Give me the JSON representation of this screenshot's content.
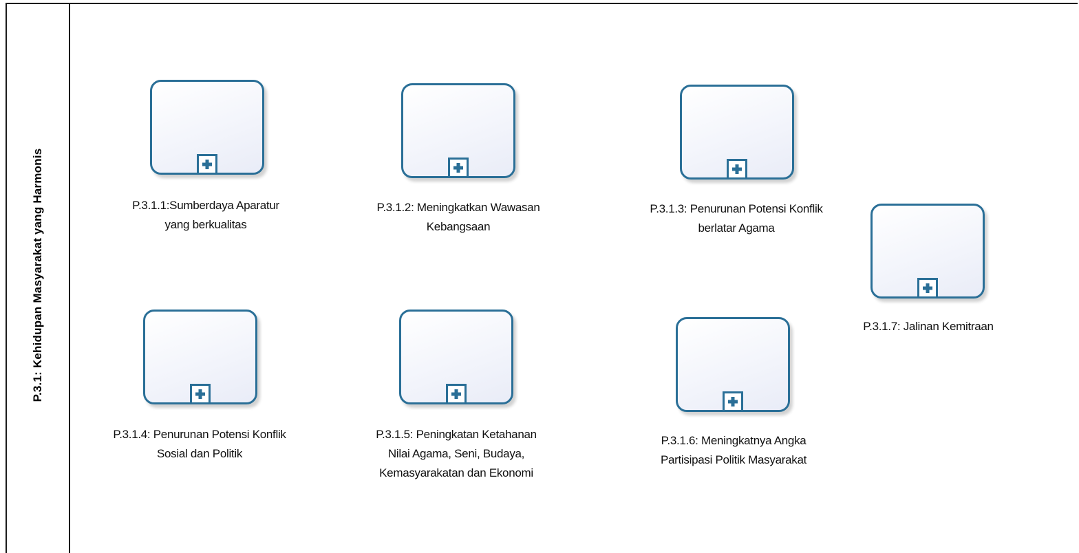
{
  "lane": {
    "title": "P.3.1: Kehidupan Masyarakat yang Harmonis"
  },
  "tasks": [
    {
      "lines": [
        "P.3.1.1:Sumberdaya Aparatur",
        "yang berkualitas"
      ]
    },
    {
      "lines": [
        "P.3.1.2: Meningkatkan Wawasan",
        "Kebangsaan"
      ]
    },
    {
      "lines": [
        "P.3.1.3: Penurunan Potensi Konflik",
        "berlatar Agama"
      ]
    },
    {
      "lines": [
        "P.3.1.4: Penurunan Potensi Konflik",
        "Sosial dan Politik"
      ]
    },
    {
      "lines": [
        "P.3.1.5: Peningkatan Ketahanan",
        "Nilai Agama, Seni, Budaya,",
        "Kemasyarakatan dan Ekonomi"
      ]
    },
    {
      "lines": [
        "P.3.1.6: Meningkatnya Angka",
        "Partisipasi Politik Masyarakat"
      ]
    },
    {
      "lines": [
        "P.3.1.7: Jalinan Kemitraan"
      ]
    }
  ],
  "icons": {
    "expand": "plus-icon"
  },
  "colors": {
    "task_border": "#2a6f97",
    "lane_border": "#1a1a1a"
  }
}
